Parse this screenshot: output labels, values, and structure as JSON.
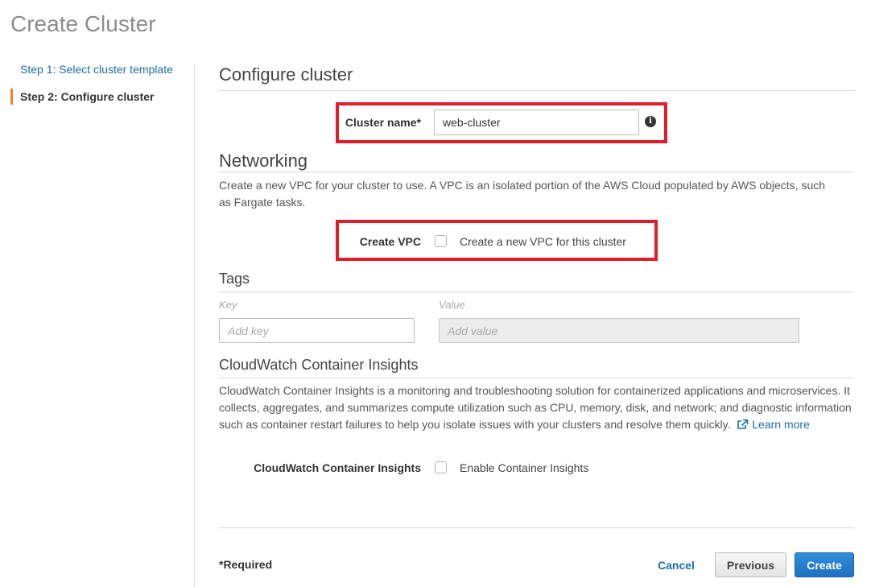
{
  "page": {
    "title": "Create Cluster"
  },
  "steps": [
    {
      "label": "Step 1: Select cluster template",
      "active": false
    },
    {
      "label": "Step 2: Configure cluster",
      "active": true
    }
  ],
  "configure": {
    "heading": "Configure cluster",
    "cluster_name_label": "Cluster name*",
    "cluster_name_value": "web-cluster",
    "info_glyph": "i"
  },
  "networking": {
    "heading": "Networking",
    "description_line1": "Create a new VPC for your cluster to use. A VPC is an isolated portion of the AWS Cloud populated by AWS objects, such",
    "description_line2": "as Fargate tasks.",
    "create_vpc_label": "Create VPC",
    "create_vpc_checkbox_label": "Create a new VPC for this cluster",
    "create_vpc_checked": false
  },
  "tags": {
    "heading": "Tags",
    "key_column": "Key",
    "value_column": "Value",
    "key_placeholder": "Add key",
    "value_placeholder": "Add value"
  },
  "insights": {
    "heading": "CloudWatch Container Insights",
    "description_line1": "CloudWatch Container Insights is a monitoring and troubleshooting solution for containerized applications and microservices. It",
    "description_line2": "collects, aggregates, and summarizes compute utilization such as CPU, memory, disk, and network; and diagnostic information",
    "description_line3": "such as container restart failures to help you isolate issues with your clusters and resolve them quickly.",
    "learn_more": "Learn more",
    "field_label": "CloudWatch Container Insights",
    "checkbox_label": "Enable Container Insights",
    "checked": false
  },
  "footer": {
    "required_note": "*Required",
    "cancel_label": "Cancel",
    "previous_label": "Previous",
    "create_label": "Create"
  },
  "colors": {
    "accent_orange": "#e7842a",
    "link_blue": "#1b6ea8",
    "primary_button": "#1f6fc0",
    "highlight_red": "#e01d2b"
  },
  "icons": {
    "info": "info-circle-icon",
    "external_link": "external-link-icon"
  }
}
